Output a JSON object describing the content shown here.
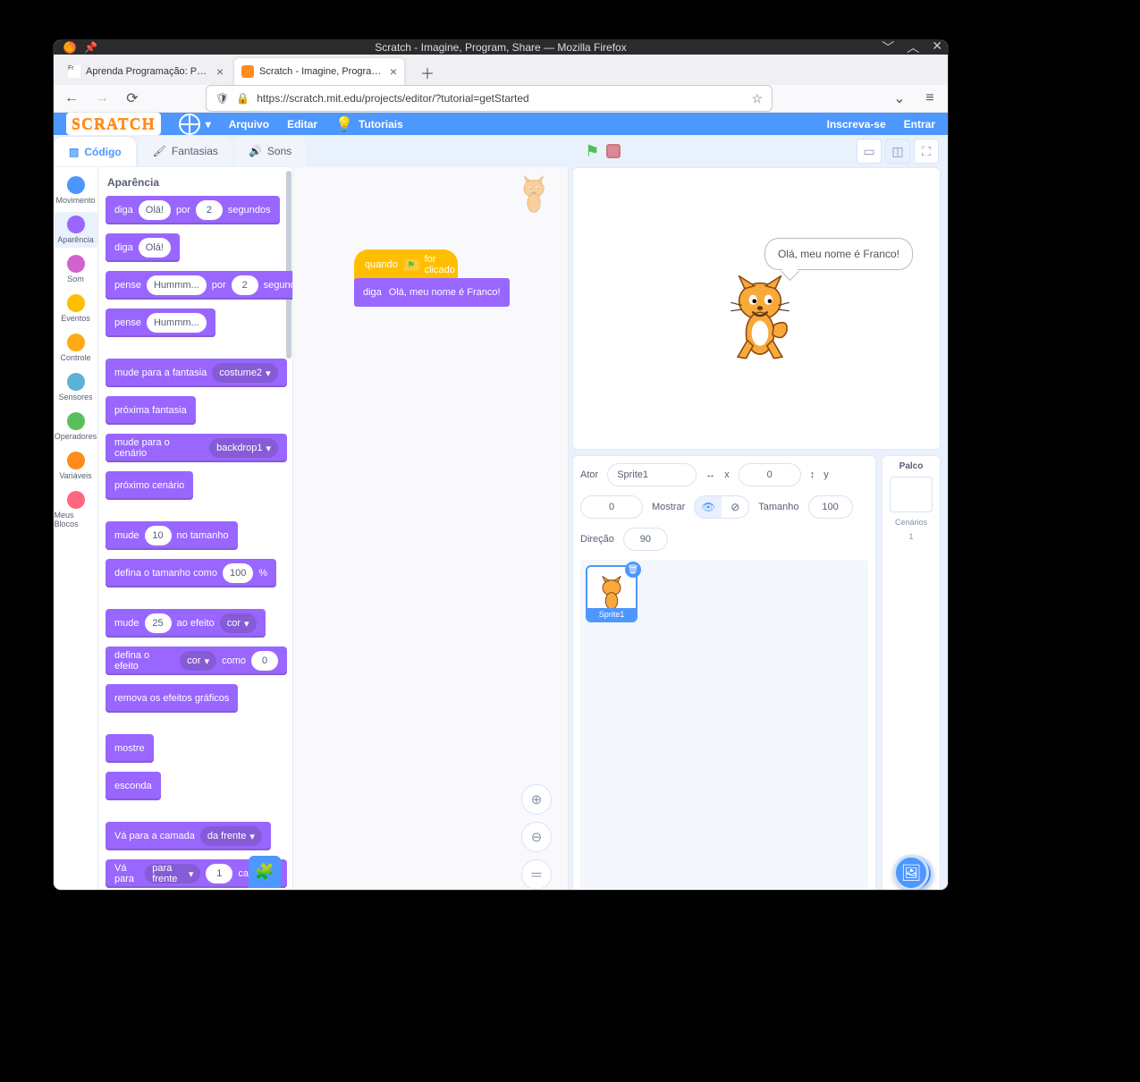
{
  "window": {
    "title": "Scratch - Imagine, Program, Share — Mozilla Firefox"
  },
  "tabs": [
    {
      "title": "Aprenda Programação: Ponto"
    },
    {
      "title": "Scratch - Imagine, Program, S",
      "active": true
    }
  ],
  "url": "https://scratch.mit.edu/projects/editor/?tutorial=getStarted",
  "menu": {
    "file": "Arquivo",
    "edit": "Editar",
    "tutorials": "Tutoriais",
    "signup": "Inscreva-se",
    "signin": "Entrar",
    "logo": "SCRATCH"
  },
  "editor_tabs": {
    "code": "Código",
    "costumes": "Fantasias",
    "sounds": "Sons"
  },
  "categories": [
    {
      "name": "Movimento",
      "color": "#4c97ff"
    },
    {
      "name": "Aparência",
      "color": "#9966ff",
      "active": true
    },
    {
      "name": "Som",
      "color": "#cf63cf"
    },
    {
      "name": "Eventos",
      "color": "#ffbf00"
    },
    {
      "name": "Controle",
      "color": "#ffab19"
    },
    {
      "name": "Sensores",
      "color": "#5cb1d6"
    },
    {
      "name": "Operadores",
      "color": "#59c059"
    },
    {
      "name": "Variáveis",
      "color": "#ff8c1a"
    },
    {
      "name": "Meus Blocos",
      "color": "#ff6680"
    }
  ],
  "palette": {
    "heading": "Aparência",
    "blocks": {
      "say_for": {
        "label1": "diga",
        "val": "Olá!",
        "label2": "por",
        "num": "2",
        "label3": "segundos"
      },
      "say": {
        "label1": "diga",
        "val": "Olá!"
      },
      "think_for": {
        "label1": "pense",
        "val": "Hummm...",
        "label2": "por",
        "num": "2",
        "label3": "segundos"
      },
      "think": {
        "label1": "pense",
        "val": "Hummm..."
      },
      "switch_costume": {
        "label": "mude para a fantasia",
        "dd": "costume2"
      },
      "next_costume": {
        "label": "próxima fantasia"
      },
      "switch_backdrop": {
        "label": "mude para o cenário",
        "dd": "backdrop1"
      },
      "next_backdrop": {
        "label": "próximo cenário"
      },
      "change_size": {
        "label1": "mude",
        "num": "10",
        "label2": "no tamanho"
      },
      "set_size": {
        "label1": "defina o tamanho como",
        "num": "100",
        "label2": "%"
      },
      "change_effect": {
        "label1": "mude",
        "num": "25",
        "label2": "ao efeito",
        "dd": "cor"
      },
      "set_effect": {
        "label1": "defina o efeito",
        "dd": "cor",
        "label2": "como",
        "num": "0"
      },
      "clear_effects": {
        "label": "remova os efeitos gráficos"
      },
      "show": {
        "label": "mostre"
      },
      "hide": {
        "label": "esconda"
      },
      "go_layer": {
        "label": "Vá para a camada",
        "dd": "da frente"
      },
      "go_layers": {
        "label1": "Vá para",
        "dd": "para frente",
        "num": "1",
        "label2": "camadas"
      }
    }
  },
  "script": {
    "hat": {
      "pre": "quando",
      "post": "for clicado"
    },
    "say_block": {
      "label": "diga",
      "val": "Olá, meu nome é Franco!"
    }
  },
  "stage": {
    "speech": "Olá, meu nome é Franco!"
  },
  "sprite_info": {
    "label_sprite": "Ator",
    "name": "Sprite1",
    "x_label": "x",
    "x": "0",
    "y_label": "y",
    "y": "0",
    "show_label": "Mostrar",
    "size_label": "Tamanho",
    "size": "100",
    "dir_label": "Direção",
    "dir": "90"
  },
  "sprite_tile": {
    "name": "Sprite1"
  },
  "stage_panel": {
    "title": "Palco",
    "backdrops_label": "Cenários",
    "backdrops_count": "1"
  }
}
